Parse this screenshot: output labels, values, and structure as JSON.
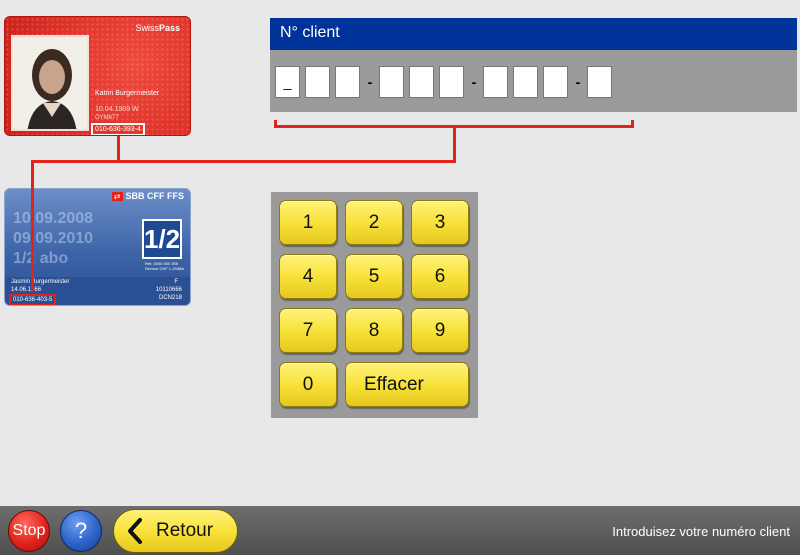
{
  "swisspass": {
    "brand_prefix": "Swiss",
    "brand_suffix": "Pass",
    "holder_name": "Katrin Burgermeister",
    "dob": "10.04.1969 W",
    "code": "OYM677",
    "customer_number": "010-636-393-4"
  },
  "halffare": {
    "operator": "SBB CFF FFS",
    "badge": "1/2",
    "fine_print": [
      "Ref.   0000 000 356",
      "Service CHF 1.15/Min"
    ],
    "holder_name": "Jasmin Burgermeister",
    "dob": "14.06.1966",
    "customer_number": "010-636-403-5",
    "gender": "F",
    "code1": "10110666",
    "code2": "DCN218"
  },
  "client": {
    "title": "N° client",
    "digits": [
      "_",
      "",
      "",
      "",
      "",
      "",
      "",
      "",
      "",
      ""
    ],
    "separator": "-"
  },
  "keypad": {
    "keys": [
      "1",
      "2",
      "3",
      "4",
      "5",
      "6",
      "7",
      "8",
      "9",
      "0"
    ],
    "clear_label": "Effacer"
  },
  "footer": {
    "stop_label": "Stop",
    "help_label": "?",
    "back_label": "Retour",
    "status_text": "Introduisez votre numéro client"
  },
  "colors": {
    "header_blue": "#003399",
    "key_yellow": "#f8e23a",
    "connector_red": "#e2231a",
    "panel_grey": "#9a9a9a"
  }
}
